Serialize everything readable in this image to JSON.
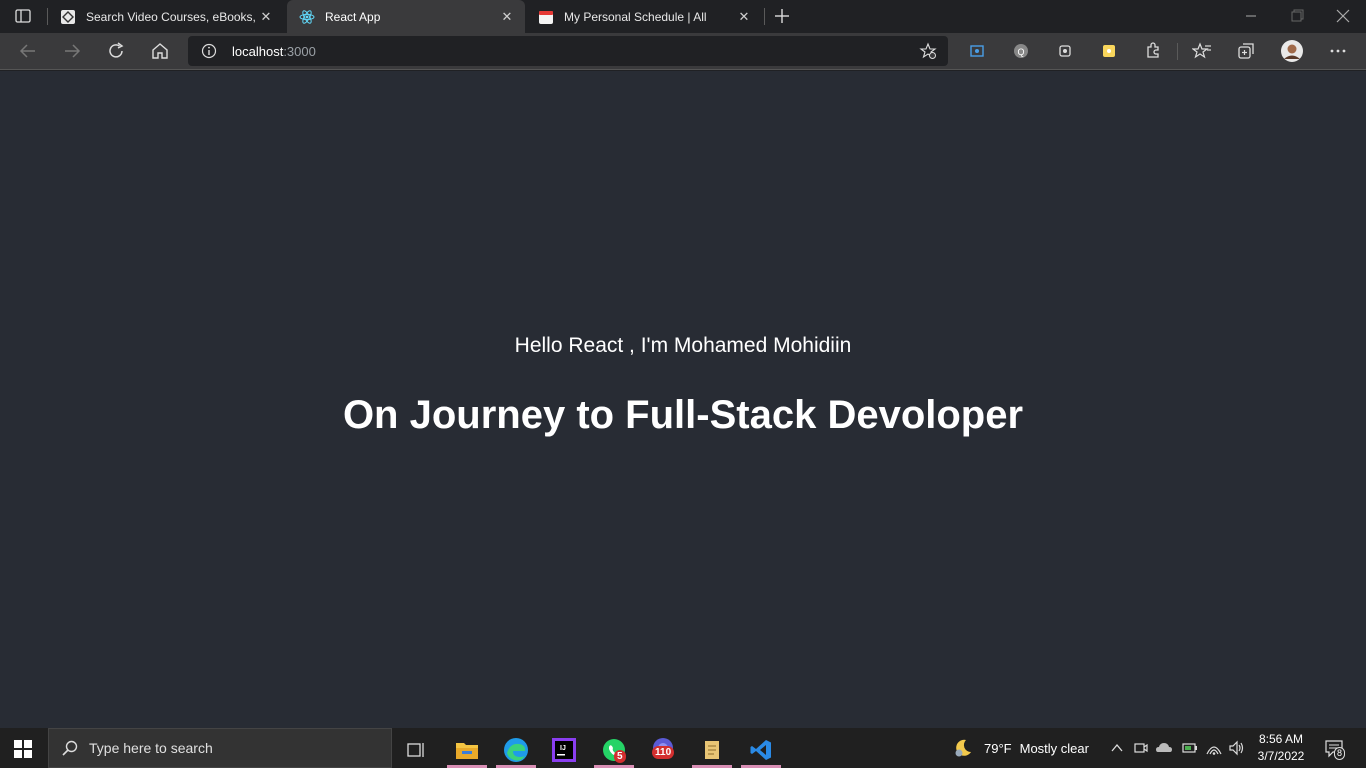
{
  "browser": {
    "tabs": [
      {
        "title": "Search Video Courses, eBooks, Paths and more",
        "icon": "packt-icon"
      },
      {
        "title": "React App",
        "icon": "react-icon"
      },
      {
        "title": "My Personal Schedule | All",
        "icon": "calendar-icon"
      }
    ],
    "address": {
      "host": "localhost",
      "port": ":3000"
    }
  },
  "page": {
    "greeting": "Hello React , I'm Mohamed Mohidiin",
    "headline": "On Journey to Full-Stack Devoloper"
  },
  "taskbar": {
    "search_placeholder": "Type here to search",
    "whatsapp_badge": "5",
    "app_badge": "110",
    "weather_temp": "79°F",
    "weather_text": "Mostly clear",
    "time": "8:56 AM",
    "date": "3/7/2022",
    "notification_count": "8"
  },
  "colors": {
    "page_bg": "#282c34",
    "accent_underline": "#d98fb5"
  }
}
